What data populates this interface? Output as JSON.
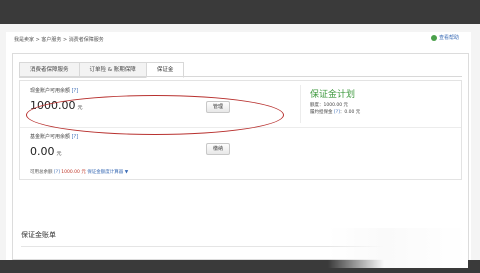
{
  "breadcrumb": "我是卖家 > 客户服务 > 消费者保障服务",
  "help_link": "查看帮助",
  "tabs": [
    {
      "label": "消费者保障服务"
    },
    {
      "label": "订单险 & 账期保障"
    },
    {
      "label": "保证金"
    }
  ],
  "cash_account": {
    "label": "现金账户可用余额",
    "hint": "[?]",
    "amount": "1000.00",
    "unit": "元",
    "button": "管理"
  },
  "fund_account": {
    "label": "基金账户可用余额",
    "hint": "[?]",
    "amount": "0.00",
    "unit": "元",
    "button": "缴纳"
  },
  "guarantee": {
    "title": "保证金计划",
    "quota_label": "额度：",
    "quota_value": "1000.00 元",
    "frozen_label": "履约担保金",
    "frozen_hint": "[?]",
    "frozen_value": "：0.00 元"
  },
  "footer": {
    "label": "可用总余额",
    "hint": "[?]",
    "value": "1000.00 元",
    "link": "保证金额度计算器"
  },
  "section_title": "保证金账单",
  "colors": {
    "annotation": "#b8312f",
    "accent_green": "#3f9a3f",
    "link_blue": "#3a6bb5"
  }
}
